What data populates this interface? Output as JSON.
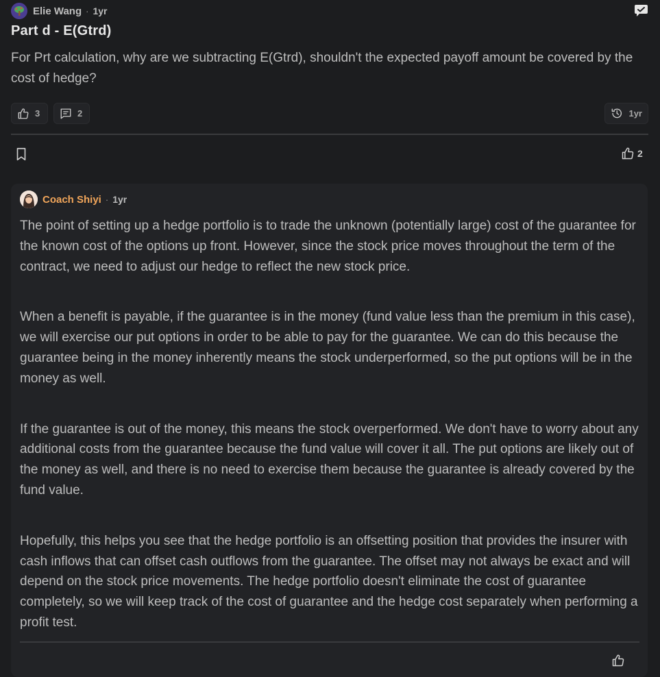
{
  "post": {
    "author": "Elie Wang",
    "separator": "·",
    "time": "1yr",
    "title": "Part d - E(Gtrd)",
    "body": "For Prt calculation, why are we subtracting E(Gtrd), shouldn't the expected payoff amount be covered by the cost of hedge?",
    "likes": "3",
    "comments": "2",
    "history_time": "1yr",
    "total_likes": "2"
  },
  "reply": {
    "author": "Coach Shiyi",
    "separator": "·",
    "time": "1yr",
    "paragraphs": [
      "The point of setting up a hedge portfolio is to trade the unknown (potentially large) cost of the guarantee for the known cost of the options up front. However, since the stock price moves throughout the term of the contract, we need to adjust our hedge to reflect the new stock price.",
      "When a benefit is payable, if the guarantee is in the money (fund value less than the premium in this case), we will exercise our put options in order to be able to pay for the guarantee. We can do this because the guarantee being in the money inherently means the stock underperformed, so the put options will be in the money as well.",
      "If the guarantee is out of the money, this means the stock overperformed. We don't have to worry about any additional costs from the guarantee because the fund value will cover it all. The put options are likely out of the money as well, and there is no need to exercise them because the guarantee is already covered by the fund value.",
      "Hopefully, this helps you see that the hedge portfolio is an offsetting position that provides the insurer with cash inflows that can offset cash outflows from the guarantee. The offset may not always be exact and will depend on the stock price movements. The hedge portfolio doesn't eliminate the cost of guarantee completely, so we will keep track of the cost of guarantee and the hedge cost separately when performing a profit test."
    ]
  },
  "colors": {
    "background": "#1c1d1f",
    "card": "#222326",
    "coach_accent": "#f0a55a",
    "text": "#bdbdbd"
  },
  "icons": [
    "tree-avatar-icon",
    "chat-check-icon",
    "thumbs-up-icon",
    "comment-icon",
    "history-icon",
    "bookmark-icon"
  ]
}
